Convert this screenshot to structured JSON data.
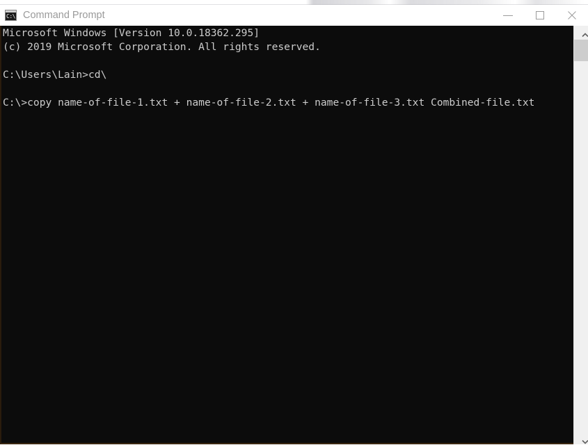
{
  "window": {
    "title": "Command Prompt",
    "icon": "cmd-icon",
    "icon_glyph": "C:\\.",
    "colors": {
      "titlebar_bg": "#ffffff",
      "title_text": "#9a9a9a",
      "console_bg": "#0c0c0c",
      "console_text": "#cccccc",
      "scrollbar_track": "#f0f0f0",
      "scrollbar_thumb": "#cdcdcd",
      "window_border": "#3a2610"
    },
    "controls": [
      {
        "name": "minimize",
        "label": "Minimize",
        "glyph": "minimize-icon"
      },
      {
        "name": "maximize",
        "label": "Maximize",
        "glyph": "maximize-icon"
      },
      {
        "name": "close",
        "label": "Close",
        "glyph": "close-icon"
      }
    ]
  },
  "console": {
    "lines": [
      "Microsoft Windows [Version 10.0.18362.295]",
      "(c) 2019 Microsoft Corporation. All rights reserved.",
      "",
      "C:\\Users\\Lain>cd\\",
      "",
      "C:\\>copy name-of-file-1.txt + name-of-file-2.txt + name-of-file-3.txt Combined-file.txt"
    ],
    "text": "Microsoft Windows [Version 10.0.18362.295]\n(c) 2019 Microsoft Corporation. All rights reserved.\n\nC:\\Users\\Lain>cd\\\n\nC:\\>copy name-of-file-1.txt + name-of-file-2.txt + name-of-file-3.txt Combined-file.txt",
    "version_banner": "Microsoft Windows [Version 10.0.18362.295]",
    "copyright_banner": "(c) 2019 Microsoft Corporation. All rights reserved.",
    "prompt_1": "C:\\Users\\Lain>",
    "command_1": "cd\\",
    "prompt_2": "C:\\>",
    "command_2": "copy name-of-file-1.txt + name-of-file-2.txt + name-of-file-3.txt Combined-file.txt"
  },
  "scrollbar": {
    "up_arrow": "chevron-up-icon",
    "down_arrow": "chevron-down-icon",
    "thumb_position": "top"
  }
}
